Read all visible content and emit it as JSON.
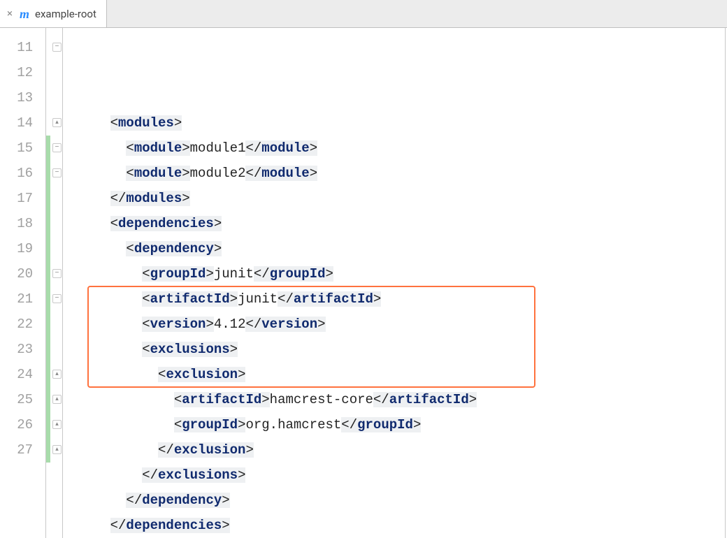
{
  "tab": {
    "name": "example-root",
    "icon_label": "m",
    "close_label": "×"
  },
  "editor": {
    "first_line_number": 11,
    "lines": [
      {
        "n": 11,
        "indent": 2,
        "open": "modules",
        "close": null,
        "self_close": false
      },
      {
        "n": 12,
        "indent": 3,
        "open": "module",
        "value": "module1",
        "close": "module"
      },
      {
        "n": 13,
        "indent": 3,
        "open": "module",
        "value": "module2",
        "close": "module"
      },
      {
        "n": 14,
        "indent": 2,
        "open": null,
        "close": "modules"
      },
      {
        "n": 15,
        "indent": 2,
        "open": "dependencies",
        "close": null
      },
      {
        "n": 16,
        "indent": 3,
        "open": "dependency",
        "close": null
      },
      {
        "n": 17,
        "indent": 4,
        "open": "groupId",
        "value": "junit",
        "close": "groupId"
      },
      {
        "n": 18,
        "indent": 4,
        "open": "artifactId",
        "value": "junit",
        "close": "artifactId"
      },
      {
        "n": 19,
        "indent": 4,
        "open": "version",
        "value": "4.12",
        "close": "version"
      },
      {
        "n": 20,
        "indent": 4,
        "open": "exclusions",
        "close": null
      },
      {
        "n": 21,
        "indent": 5,
        "open": "exclusion",
        "close": null
      },
      {
        "n": 22,
        "indent": 6,
        "open": "artifactId",
        "value": "hamcrest-core",
        "close": "artifactId"
      },
      {
        "n": 23,
        "indent": 6,
        "open": "groupId",
        "value": "org.hamcrest",
        "close": "groupId"
      },
      {
        "n": 24,
        "indent": 5,
        "open": null,
        "close": "exclusion"
      },
      {
        "n": 25,
        "indent": 4,
        "open": null,
        "close": "exclusions"
      },
      {
        "n": 26,
        "indent": 3,
        "open": null,
        "close": "dependency"
      },
      {
        "n": 27,
        "indent": 2,
        "open": null,
        "close": "dependencies"
      }
    ],
    "change_bars": [
      {
        "from": 15,
        "to": 27
      }
    ],
    "fold_markers": [
      {
        "line": 11,
        "kind": "minus"
      },
      {
        "line": 14,
        "kind": "up"
      },
      {
        "line": 15,
        "kind": "minus"
      },
      {
        "line": 16,
        "kind": "minus"
      },
      {
        "line": 20,
        "kind": "minus"
      },
      {
        "line": 21,
        "kind": "minus"
      },
      {
        "line": 24,
        "kind": "up"
      },
      {
        "line": 25,
        "kind": "up"
      },
      {
        "line": 26,
        "kind": "up"
      },
      {
        "line": 27,
        "kind": "up"
      }
    ],
    "highlight_range": {
      "from": 21,
      "to": 24
    }
  }
}
